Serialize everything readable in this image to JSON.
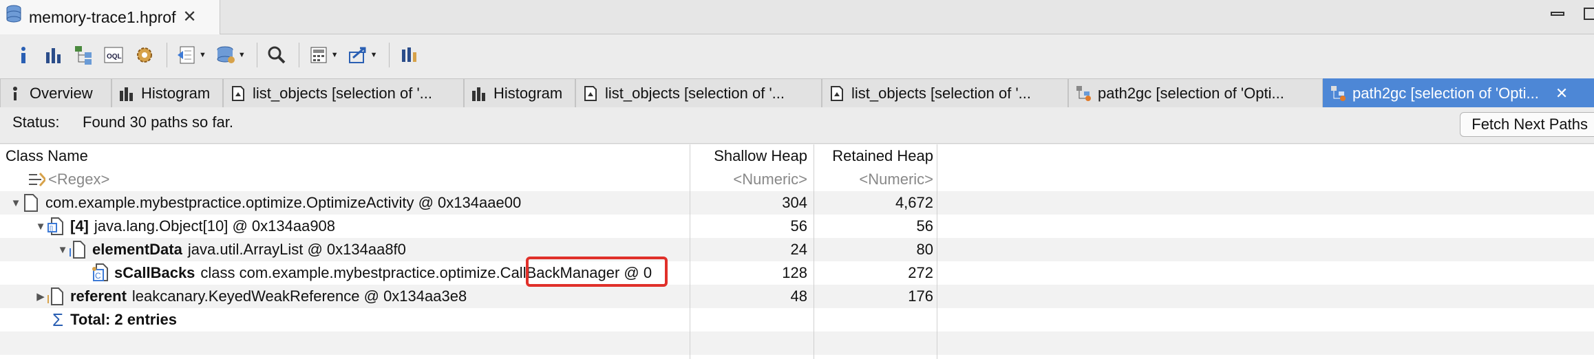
{
  "editor": {
    "title": "memory-trace1.hprof"
  },
  "tabs": [
    {
      "label": "Overview",
      "icon": "info-icon"
    },
    {
      "label": "Histogram",
      "icon": "histogram-icon"
    },
    {
      "label": "list_objects  [selection of '...",
      "icon": "list-objects-icon"
    },
    {
      "label": "Histogram",
      "icon": "histogram-icon"
    },
    {
      "label": "list_objects  [selection of '...",
      "icon": "list-objects-icon"
    },
    {
      "label": "list_objects  [selection of '...",
      "icon": "list-objects-icon"
    },
    {
      "label": "path2gc  [selection of 'Opti...",
      "icon": "path2gc-icon"
    },
    {
      "label": "path2gc  [selection of 'Opti...",
      "icon": "path2gc-icon",
      "active": true
    }
  ],
  "status": {
    "label": "Status:",
    "text": "Found 30 paths so far.",
    "fetch_button": "Fetch Next Paths"
  },
  "table": {
    "headers": {
      "class_name": "Class Name",
      "shallow": "Shallow Heap",
      "retained": "Retained Heap"
    },
    "filter_row": {
      "name": "<Regex>",
      "shallow": "<Numeric>",
      "retained": "<Numeric>"
    },
    "rows": [
      {
        "prefix": "",
        "name": "com.example.mybestpractice.optimize.OptimizeActivity @ 0x134aae00",
        "shallow": "304",
        "retained": "4,672"
      },
      {
        "prefix": "[4]",
        "name": "java.lang.Object[10] @ 0x134aa908",
        "shallow": "56",
        "retained": "56"
      },
      {
        "prefix": "elementData",
        "name": "java.util.ArrayList @ 0x134aa8f0",
        "shallow": "24",
        "retained": "80"
      },
      {
        "prefix": "sCallBacks",
        "name": "class com.example.mybestpractice.optimize.CallBackManager @ 0",
        "shallow": "128",
        "retained": "272"
      },
      {
        "prefix": "referent",
        "name": "leakcanary.KeyedWeakReference @ 0x134aa3e8",
        "shallow": "48",
        "retained": "176"
      }
    ],
    "total": "Total: 2 entries"
  },
  "colors": {
    "active_tab": "#4d87d6",
    "highlight": "#e0302a"
  }
}
